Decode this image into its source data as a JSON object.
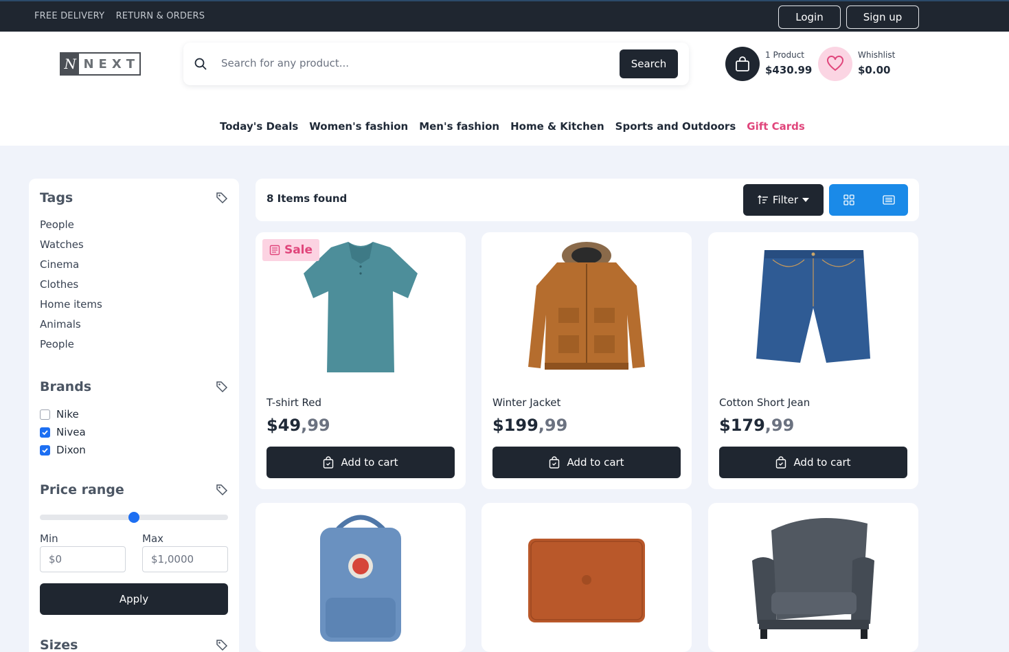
{
  "topbar": {
    "links": [
      "FREE DELIVERY",
      "RETURN & ORDERS"
    ],
    "login_label": "Login",
    "signup_label": "Sign up"
  },
  "header": {
    "logo_mark": "N",
    "logo_text": "NEXT",
    "search": {
      "placeholder": "Search for any product...",
      "button_label": "Search"
    },
    "cart": {
      "count_label": "1 Product",
      "total": "$430.99"
    },
    "wishlist": {
      "label": "Whishlist",
      "total": "$0.00"
    }
  },
  "nav": {
    "items": [
      "Today's Deals",
      "Women's fashion",
      "Men's fashion",
      "Home & Kitchen",
      "Sports and Outdoors",
      "Gift Cards"
    ],
    "highlight_color": "#e0457b"
  },
  "sidebar": {
    "tags_title": "Tags",
    "tags": [
      "People",
      "Watches",
      "Cinema",
      "Clothes",
      "Home items",
      "Animals",
      "People"
    ],
    "brands_title": "Brands",
    "brands": [
      {
        "label": "Nike",
        "checked": false
      },
      {
        "label": "Nivea",
        "checked": true
      },
      {
        "label": "Dixon",
        "checked": true
      }
    ],
    "price_title": "Price range",
    "price_slider_level": 0.5,
    "min_label": "Min",
    "min_placeholder": "$0",
    "max_label": "Max",
    "max_placeholder": "$1,0000",
    "apply_label": "Apply",
    "sizes_title": "Sizes"
  },
  "toolbar": {
    "items_found": "8 Items found",
    "filter_label": "Filter",
    "accent_color": "#1a8ae8"
  },
  "products": [
    {
      "name": "T-shirt Red",
      "price_main": "$49",
      "price_cents": ",99",
      "sale": "Sale",
      "image": "tshirt"
    },
    {
      "name": "Winter Jacket",
      "price_main": "$199",
      "price_cents": ",99",
      "image": "jacket"
    },
    {
      "name": "Cotton Short Jean",
      "price_main": "$179",
      "price_cents": ",99",
      "image": "jeans"
    },
    {
      "image": "backpack"
    },
    {
      "image": "laptop-sleeve"
    },
    {
      "image": "armchair"
    }
  ],
  "add_to_cart_label": "Add to cart"
}
